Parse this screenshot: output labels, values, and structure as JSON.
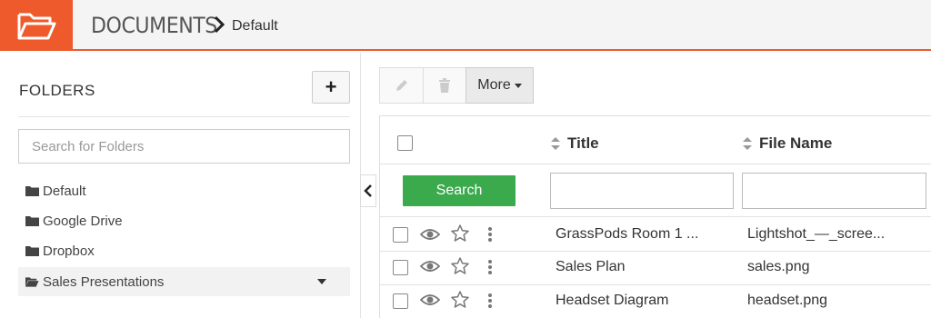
{
  "header": {
    "logo_icon": "folder-open-icon",
    "title": "DOCUMENTS",
    "breadcrumb_icon": "chevron-right-icon",
    "breadcrumb": "Default",
    "accent_color": "#ee5a2c"
  },
  "sidebar": {
    "heading": "FOLDERS",
    "add_button": "+",
    "search_placeholder": "Search for Folders",
    "folders": [
      {
        "label": "Default",
        "icon": "folder-icon"
      },
      {
        "label": "Google Drive",
        "icon": "folder-icon"
      },
      {
        "label": "Dropbox",
        "icon": "folder-icon"
      },
      {
        "label": "Sales Presentations",
        "icon": "folder-open-icon",
        "active": true
      }
    ]
  },
  "toolbar": {
    "edit_icon": "pencil-icon",
    "delete_icon": "trash-icon",
    "more_label": "More"
  },
  "table": {
    "columns": [
      {
        "label": "Title"
      },
      {
        "label": "File Name"
      }
    ],
    "search_button": "Search",
    "search_button_color": "#3aaa4c",
    "rows": [
      {
        "title": "GrassPods Room 1 ...",
        "file_name": "Lightshot_—_scree..."
      },
      {
        "title": "Sales Plan",
        "file_name": "sales.png"
      },
      {
        "title": "Headset Diagram",
        "file_name": "headset.png"
      }
    ]
  }
}
